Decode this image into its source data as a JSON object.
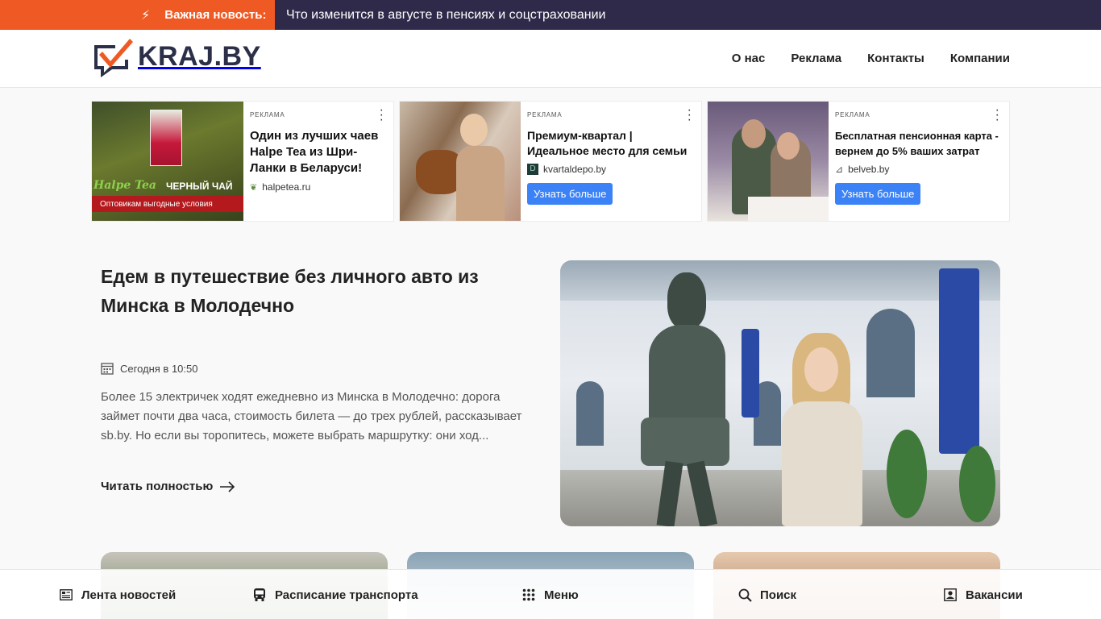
{
  "breaking": {
    "label": "Важная новость:",
    "text": "Что изменится в августе в пенсиях и соцстраховании"
  },
  "header": {
    "logo_text": "KRAJ.BY",
    "nav": [
      "О нас",
      "Реклама",
      "Контакты",
      "Компании"
    ]
  },
  "ads": [
    {
      "tag": "РЕКЛАМА",
      "title": "Один из лучших чаев Halpe Tea из Шри-Ланки в Беларуси!",
      "domain": "halpetea.ru",
      "image_brand": "Halpe Tea",
      "image_caption": "ЧЕРНЫЙ ЧАЙ",
      "image_strip": "Оптовикам выгодные условия"
    },
    {
      "tag": "РЕКЛАМА",
      "title": "Премиум-квартал | Идеальное место для семьи",
      "domain": "kvartaldepo.by",
      "button": "Узнать больше"
    },
    {
      "tag": "РЕКЛАМА",
      "title": "Бесплатная пенсионная карта - вернем до 5% ваших затрат",
      "domain": "belveb.by",
      "button": "Узнать больше"
    }
  ],
  "feature": {
    "title": "Едем в путешествие без личного авто из Минска в Молодечно",
    "date": "Сегодня в 10:50",
    "description": "Более 15 электричек ходят ежедневно из Минска в Молодечно: дорога займет почти два часа, стоимость билета — до трех рублей, рассказывает sb.by. Но если вы торопитесь, можете выбрать маршрутку: они ход...",
    "read_more": "Читать полностью"
  },
  "bottom_nav": [
    {
      "label": "Лента новостей",
      "icon": "newspaper-icon"
    },
    {
      "label": "Расписание транспорта",
      "icon": "bus-icon"
    },
    {
      "label": "Меню",
      "icon": "grid-icon"
    },
    {
      "label": "Поиск",
      "icon": "search-icon"
    },
    {
      "label": "Вакансии",
      "icon": "badge-icon"
    }
  ],
  "colors": {
    "accent_orange": "#ef5a24",
    "dark_navy": "#2f2a4a",
    "button_blue": "#3b82f6"
  }
}
